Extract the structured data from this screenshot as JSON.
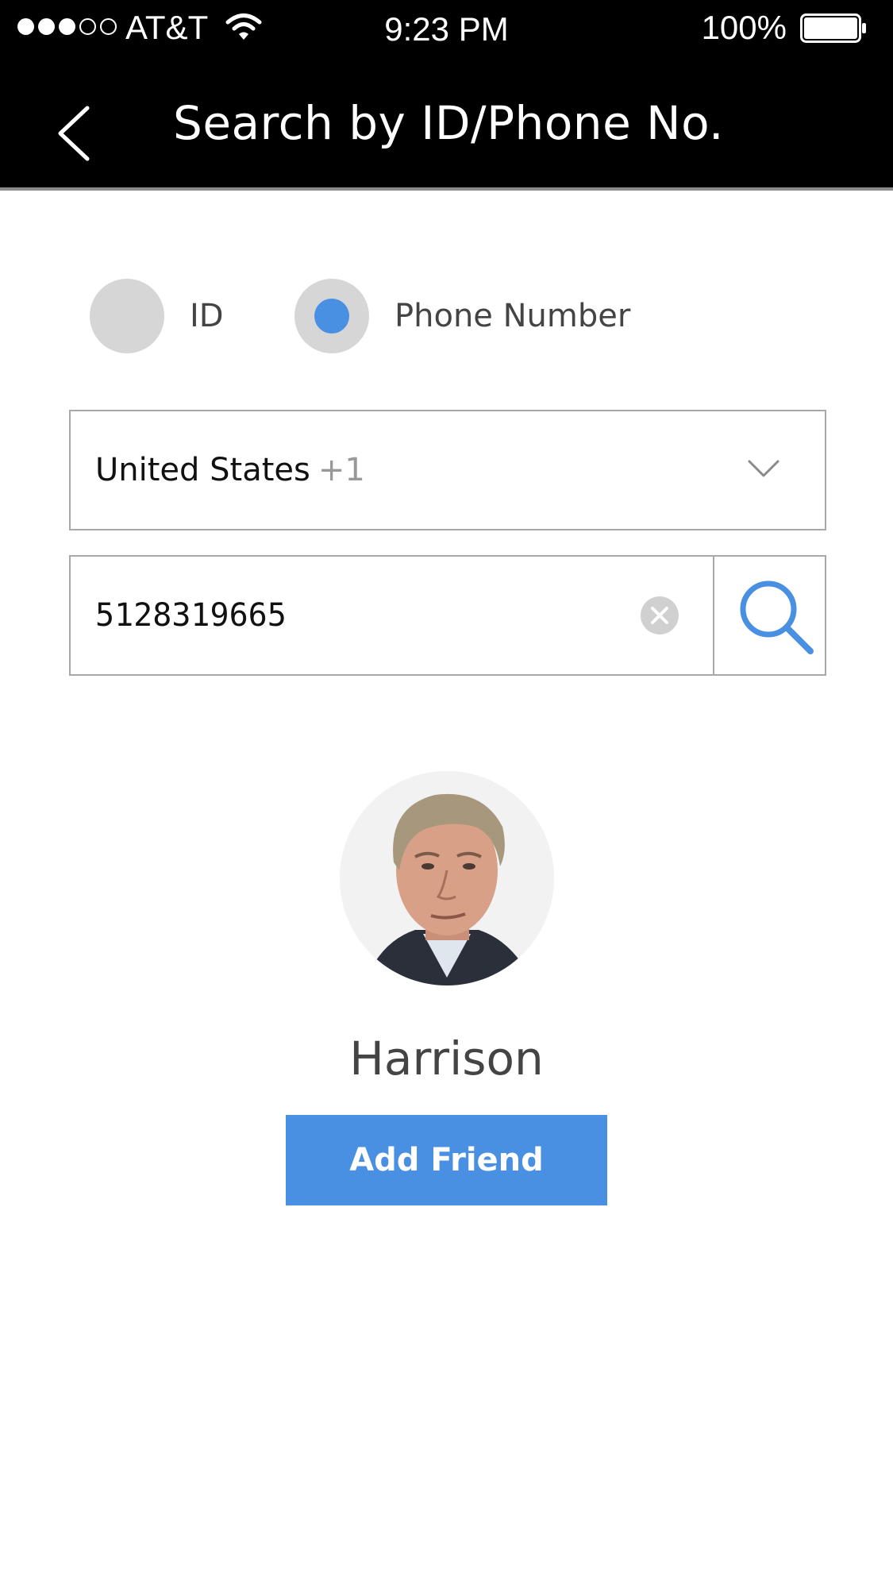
{
  "status_bar": {
    "carrier": "AT&T",
    "time": "9:23 PM",
    "battery": "100%",
    "signal_bars_filled": 3,
    "signal_bars_total": 5,
    "icons": [
      "signal-dots-icon",
      "wifi-icon",
      "battery-icon"
    ]
  },
  "nav": {
    "title": "Search by ID/Phone No.",
    "back_icon": "chevron-left-icon"
  },
  "search_type": {
    "options": [
      {
        "label": "ID",
        "selected": false
      },
      {
        "label": "Phone Number",
        "selected": true
      }
    ]
  },
  "country": {
    "name": "United States",
    "code": "+1",
    "icon": "chevron-down-icon"
  },
  "phone_search": {
    "value": "5128319665",
    "clear_icon": "clear-circle-icon",
    "search_icon": "search-icon"
  },
  "result": {
    "name": "Harrison",
    "add_button_label": "Add Friend"
  },
  "colors": {
    "accent": "#4a90e2",
    "bar_background": "#000000",
    "radio_gray": "#d6d6d6",
    "border_gray": "#a8a8a8"
  }
}
